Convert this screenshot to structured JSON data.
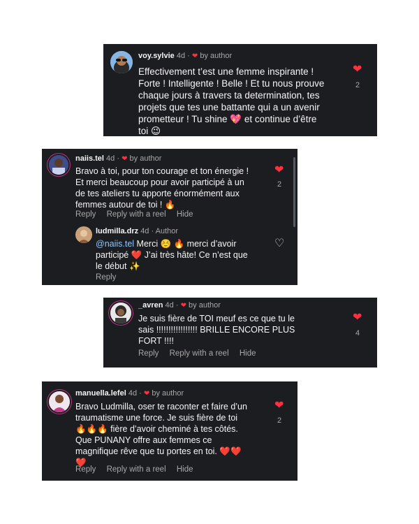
{
  "comments": [
    {
      "username": "voy.sylvie",
      "time": "4d",
      "separator": "·",
      "liked_label": "by author",
      "lines": [
        "Effectivement t’est une femme inspirante !",
        "Forte ! Intelligente ! Belle ! Et tu nous prouve",
        "chaque jours à travers ta determination, tes",
        "projets que tes une battante qui a un avenir",
        "prometteur ! Tu shine 💖 et continue d’être",
        "toi 😉"
      ],
      "likes": "2"
    },
    {
      "username": "naiis.tel",
      "time": "4d",
      "separator": "·",
      "liked_label": "by author",
      "lines": [
        "Bravo à toi, pour ton courage et ton énergie !",
        "Et merci beaucoup pour avoir participé à un",
        "de tes ateliers tu apporte énormément aux",
        "femmes autour de toi ! 🔥"
      ],
      "likes": "2",
      "actions": [
        "Reply",
        "Reply with a reel",
        "Hide"
      ],
      "reply": {
        "username": "ludmilla.drz",
        "time": "4d",
        "separator": "·",
        "badge": "Author",
        "mention": "@naiis.tel",
        "lines": [
          " Merci ☺️ 🔥 merci d’avoir",
          "participé ❤️ J’ai très hâte! Ce n’est que",
          "le début ✨"
        ],
        "action": "Reply"
      }
    },
    {
      "username": "_avren",
      "time": "4d",
      "separator": "·",
      "liked_label": "by author",
      "lines": [
        "Je suis fière de TOI meuf es ce que tu le",
        "sais !!!!!!!!!!!!!!!!! BRILLE ENCORE PLUS",
        "FORT !!!!"
      ],
      "likes": "4",
      "actions": [
        "Reply",
        "Reply with a reel",
        "Hide"
      ]
    },
    {
      "username": "manuella.lefel",
      "time": "4d",
      "separator": "·",
      "liked_label": "by author",
      "lines": [
        "Bravo Ludmilla, oser te raconter et faire d’un",
        "traumatisme une force. Je suis fière de toi",
        "🔥🔥🔥 fière d’avoir cheminé à tes côtés.",
        "Que PUNANY offre aux femmes ce",
        "magnifique rêve que tu portes en toi. ❤️❤️",
        "❤️"
      ],
      "likes": "2",
      "actions": [
        "Reply",
        "Reply with a reel",
        "Hide"
      ]
    }
  ],
  "colors": {
    "card_bg": "#1c1d21",
    "heart_red": "#ff3040",
    "muted": "#a8a8a8",
    "text": "#f5f5f5"
  },
  "icons": {
    "liked": "heart-filled-icon",
    "like": "heart-outline-icon"
  }
}
